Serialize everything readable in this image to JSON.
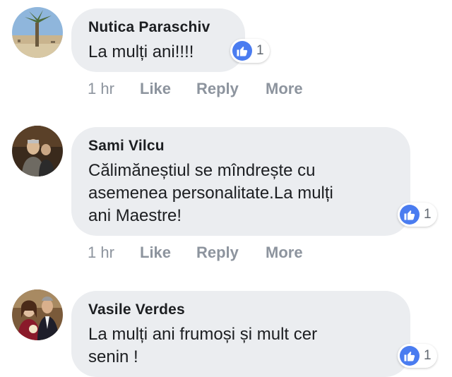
{
  "comments": [
    {
      "author": "Nutica Paraschiv",
      "text": "La mulți ani!!!!",
      "reaction_icon": "like-icon",
      "reaction_count": "1",
      "time": "1 hr",
      "like_label": "Like",
      "reply_label": "Reply",
      "more_label": "More"
    },
    {
      "author": "Sami Vilcu",
      "text_lines": [
        "Călimăneștiul se mîndrește cu",
        "asemenea personalitate.La mulți",
        "ani Maestre!"
      ],
      "reaction_icon": "like-icon",
      "reaction_count": "1",
      "time": "1 hr",
      "like_label": "Like",
      "reply_label": "Reply",
      "more_label": "More"
    },
    {
      "author": "Vasile Verdes",
      "text_lines": [
        "La mulți ani frumoși și mult cer",
        "senin !"
      ],
      "reaction_icon": "like-icon",
      "reaction_count": "1"
    }
  ],
  "colors": {
    "bubble": "#ebedf0",
    "like_blue": "#4a7cf0",
    "meta_gray": "#8d949e"
  }
}
